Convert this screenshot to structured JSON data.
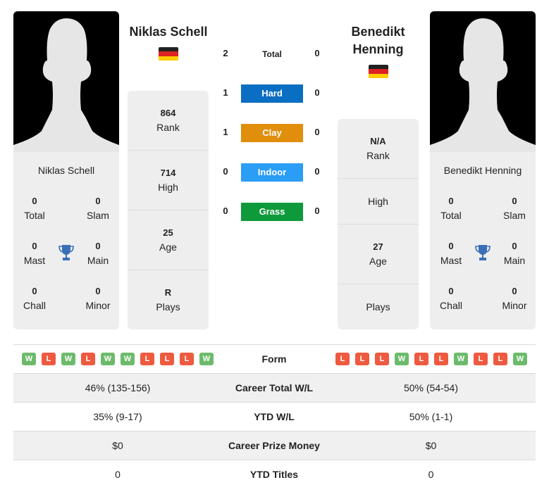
{
  "player1": {
    "name": "Niklas Schell",
    "flag": "germany-flag",
    "titles": {
      "total": "0",
      "slam": "0",
      "mast": "0",
      "main": "0",
      "chall": "0",
      "minor": "0"
    },
    "labels": {
      "total": "Total",
      "slam": "Slam",
      "mast": "Mast",
      "main": "Main",
      "chall": "Chall",
      "minor": "Minor"
    },
    "info": [
      {
        "value": "864",
        "label": "Rank"
      },
      {
        "value": "714",
        "label": "High"
      },
      {
        "value": "25",
        "label": "Age"
      },
      {
        "value": "R",
        "label": "Plays"
      }
    ],
    "form": [
      "W",
      "L",
      "W",
      "L",
      "W",
      "W",
      "L",
      "L",
      "L",
      "W"
    ]
  },
  "player2": {
    "name_line1": "Benedikt",
    "name_line2": "Henning",
    "name": "Benedikt Henning",
    "flag": "germany-flag",
    "titles": {
      "total": "0",
      "slam": "0",
      "mast": "0",
      "main": "0",
      "chall": "0",
      "minor": "0"
    },
    "labels": {
      "total": "Total",
      "slam": "Slam",
      "mast": "Mast",
      "main": "Main",
      "chall": "Chall",
      "minor": "Minor"
    },
    "info": [
      {
        "value": "N/A",
        "label": "Rank"
      },
      {
        "value": "",
        "label": "High"
      },
      {
        "value": "27",
        "label": "Age"
      },
      {
        "value": "",
        "label": "Plays"
      }
    ],
    "form": [
      "L",
      "L",
      "L",
      "W",
      "L",
      "L",
      "W",
      "L",
      "L",
      "W"
    ]
  },
  "h2h": [
    {
      "surface": "Total",
      "p1": "2",
      "p2": "0",
      "color": ""
    },
    {
      "surface": "Hard",
      "p1": "1",
      "p2": "0",
      "color": "#0a6fc2"
    },
    {
      "surface": "Clay",
      "p1": "1",
      "p2": "0",
      "color": "#e08e0b"
    },
    {
      "surface": "Indoor",
      "p1": "0",
      "p2": "0",
      "color": "#2a9df4"
    },
    {
      "surface": "Grass",
      "p1": "0",
      "p2": "0",
      "color": "#0e9a3a"
    }
  ],
  "table": {
    "form_label": "Form",
    "rows": [
      {
        "label": "Career Total W/L",
        "p1": "46% (135-156)",
        "p2": "50% (54-54)"
      },
      {
        "label": "YTD W/L",
        "p1": "35% (9-17)",
        "p2": "50% (1-1)"
      },
      {
        "label": "Career Prize Money",
        "p1": "$0",
        "p2": "$0"
      },
      {
        "label": "YTD Titles",
        "p1": "0",
        "p2": "0"
      }
    ]
  },
  "colors": {
    "trophy": "#3a6fb8",
    "win": "#6cbb6c",
    "loss": "#ee5a3f"
  }
}
